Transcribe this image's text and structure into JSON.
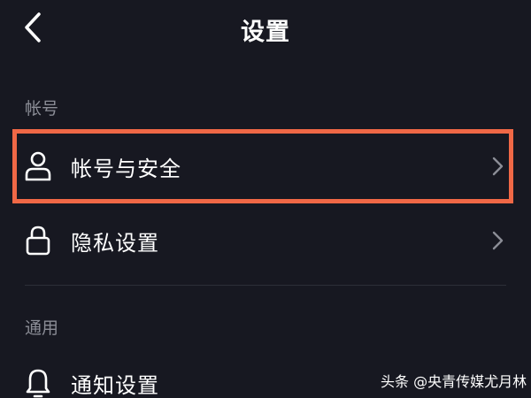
{
  "header": {
    "title": "设置",
    "back_icon": "chevron-left-icon"
  },
  "sections": [
    {
      "label": "帐号",
      "items": [
        {
          "label": "帐号与安全",
          "icon": "user-icon",
          "highlighted": true
        },
        {
          "label": "隐私设置",
          "icon": "lock-icon"
        }
      ]
    },
    {
      "label": "通用",
      "items": [
        {
          "label": "通知设置",
          "icon": "bell-icon"
        }
      ]
    }
  ],
  "watermark": "头条 @央青传媒尤月林",
  "colors": {
    "background": "#171821",
    "highlight": "#f06846",
    "section_label": "#8b8d96",
    "text": "#ffffff"
  }
}
